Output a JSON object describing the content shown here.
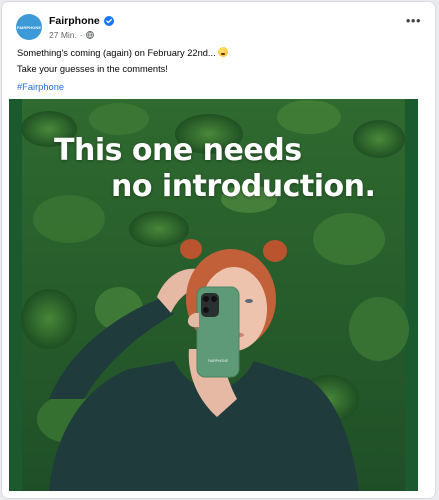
{
  "post": {
    "page_name": "Fairphone",
    "avatar_text": "FAIRPHONE",
    "timestamp": "27 Min.",
    "privacy_icon": "globe-icon",
    "more_label": "•••",
    "line1": "Something's coming (again) on February 22nd...",
    "line2": "Take your guesses in the comments!",
    "hashtag": "#Fairphone"
  },
  "media": {
    "headline_line1": "This one needs",
    "headline_line2": "no introduction.",
    "phone_brand": "FAIRPHONE"
  },
  "colors": {
    "link": "#216fdb",
    "verified": "#1877f2",
    "avatar": "#3d9ad8"
  }
}
